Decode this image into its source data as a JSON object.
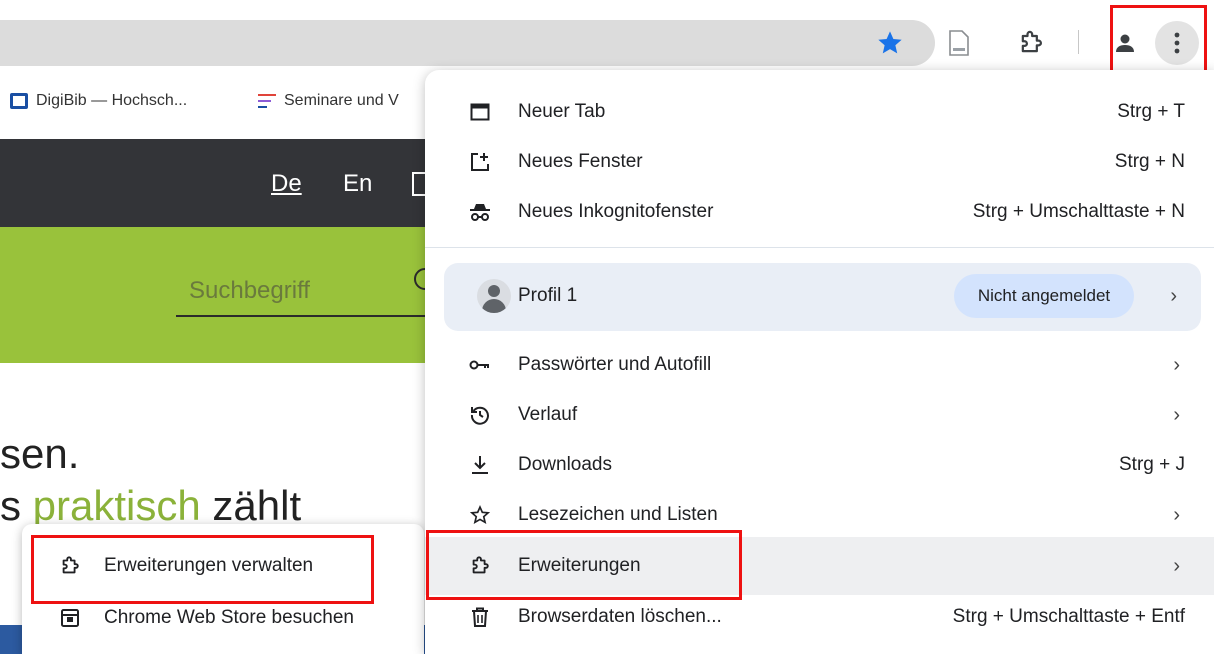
{
  "toolbar": {
    "icons": [
      "star-icon",
      "reading-list-icon",
      "extensions-icon",
      "profile-icon",
      "more-menu-icon"
    ],
    "accent": "#1a73e8"
  },
  "bookmarks": [
    {
      "label": "DigiBib — Hochsch...",
      "icon": "digibib-icon"
    },
    {
      "label": "Seminare und V",
      "icon": "seminare-icon"
    }
  ],
  "page": {
    "lang_de": "De",
    "lang_en": "En",
    "search_placeholder": "Suchbegriff",
    "hero_line1": "sen.",
    "hero_line2_prefix": "s ",
    "hero_line2_green": "praktisch",
    "hero_line2_suffix": " zählt"
  },
  "menu": {
    "items": [
      {
        "label": "Neuer Tab",
        "shortcut": "Strg + T",
        "icon": "new-tab-icon"
      },
      {
        "label": "Neues Fenster",
        "shortcut": "Strg + N",
        "icon": "new-window-icon"
      },
      {
        "label": "Neues Inkognitofenster",
        "shortcut": "Strg + Umschalttaste + N",
        "icon": "incognito-icon"
      }
    ],
    "profile": {
      "label": "Profil 1",
      "status": "Nicht angemeldet"
    },
    "items2": [
      {
        "label": "Passwörter und Autofill",
        "icon": "key-icon"
      },
      {
        "label": "Verlauf",
        "icon": "history-icon"
      },
      {
        "label": "Downloads",
        "shortcut": "Strg + J",
        "icon": "download-icon"
      },
      {
        "label": "Lesezeichen und Listen",
        "icon": "bookmark-star-icon"
      },
      {
        "label": "Erweiterungen",
        "icon": "extensions-icon"
      },
      {
        "label": "Browserdaten löschen...",
        "shortcut": "Strg + Umschalttaste + Entf",
        "icon": "trash-icon"
      }
    ],
    "chevron": "›"
  },
  "submenu": {
    "items": [
      {
        "label": "Erweiterungen verwalten",
        "icon": "extensions-icon"
      },
      {
        "label": "Chrome Web Store besuchen",
        "icon": "web-store-icon"
      }
    ]
  },
  "colors": {
    "highlight_box": "#ee1111",
    "green": "#99c23b",
    "dark": "#333438"
  }
}
